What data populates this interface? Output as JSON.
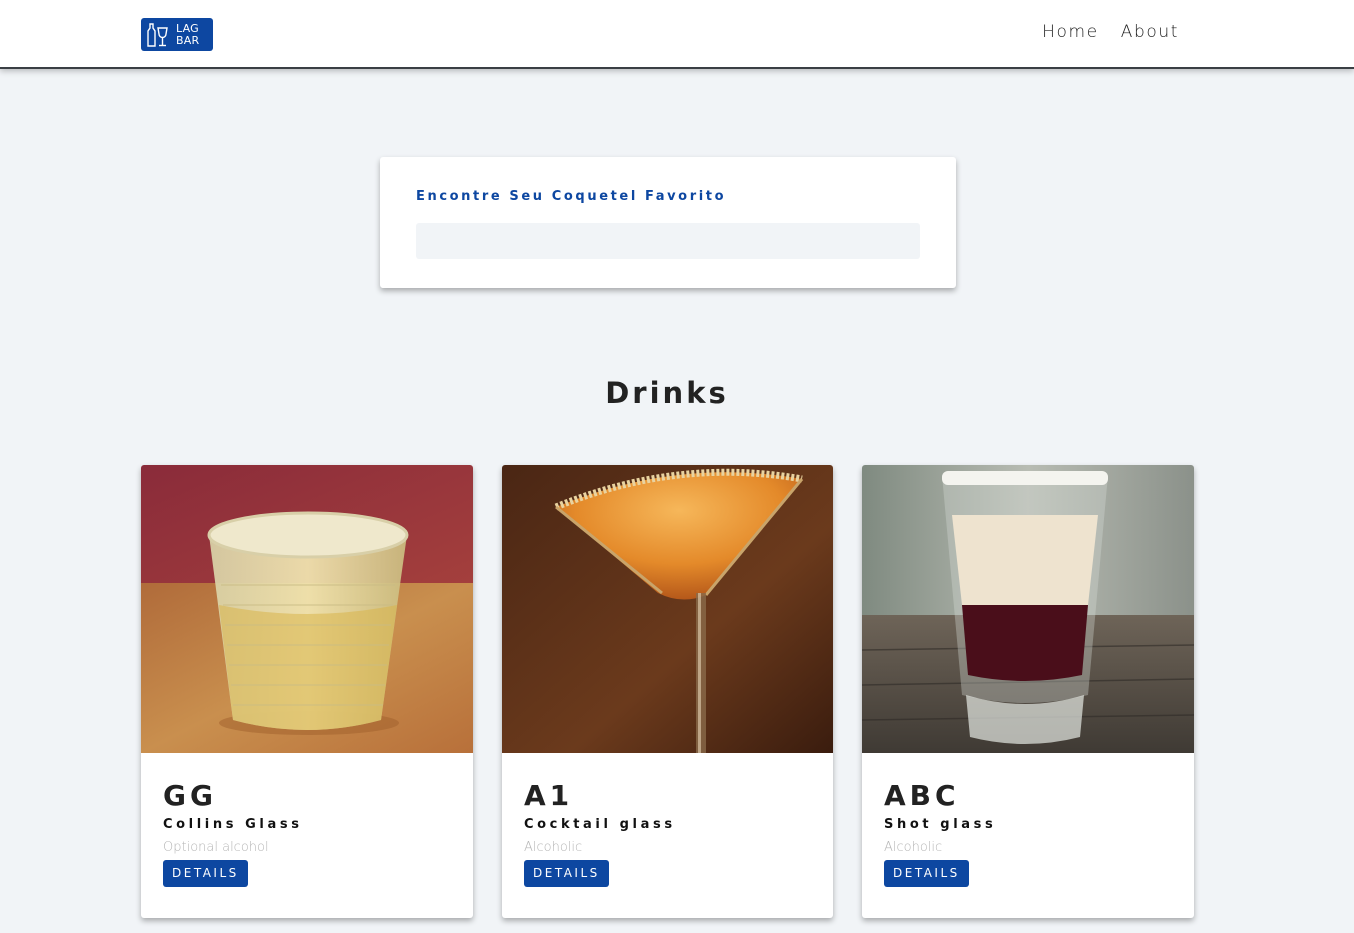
{
  "navbar": {
    "logo_text_line1": "LAG",
    "logo_text_line2": "BAR",
    "links": [
      "Home",
      "About"
    ]
  },
  "search": {
    "title": "Encontre Seu Coquetel Favorito",
    "value": "",
    "placeholder": ""
  },
  "section": {
    "title": "Drinks"
  },
  "drinks": [
    {
      "name": "GG",
      "glass": "Collins Glass",
      "alcoholic": "Optional alcohol",
      "button": "DETAILS",
      "image": "whiskey-tumbler-photo"
    },
    {
      "name": "A1",
      "glass": "Cocktail glass",
      "alcoholic": "Alcoholic",
      "button": "DETAILS",
      "image": "martini-glass-photo"
    },
    {
      "name": "ABC",
      "glass": "Shot glass",
      "alcoholic": "Alcoholic",
      "button": "DETAILS",
      "image": "layered-shot-photo"
    }
  ],
  "colors": {
    "brand": "#0d47a1",
    "background": "#f1f4f7",
    "card": "#ffffff",
    "muted_text": "#b5b5b5"
  }
}
